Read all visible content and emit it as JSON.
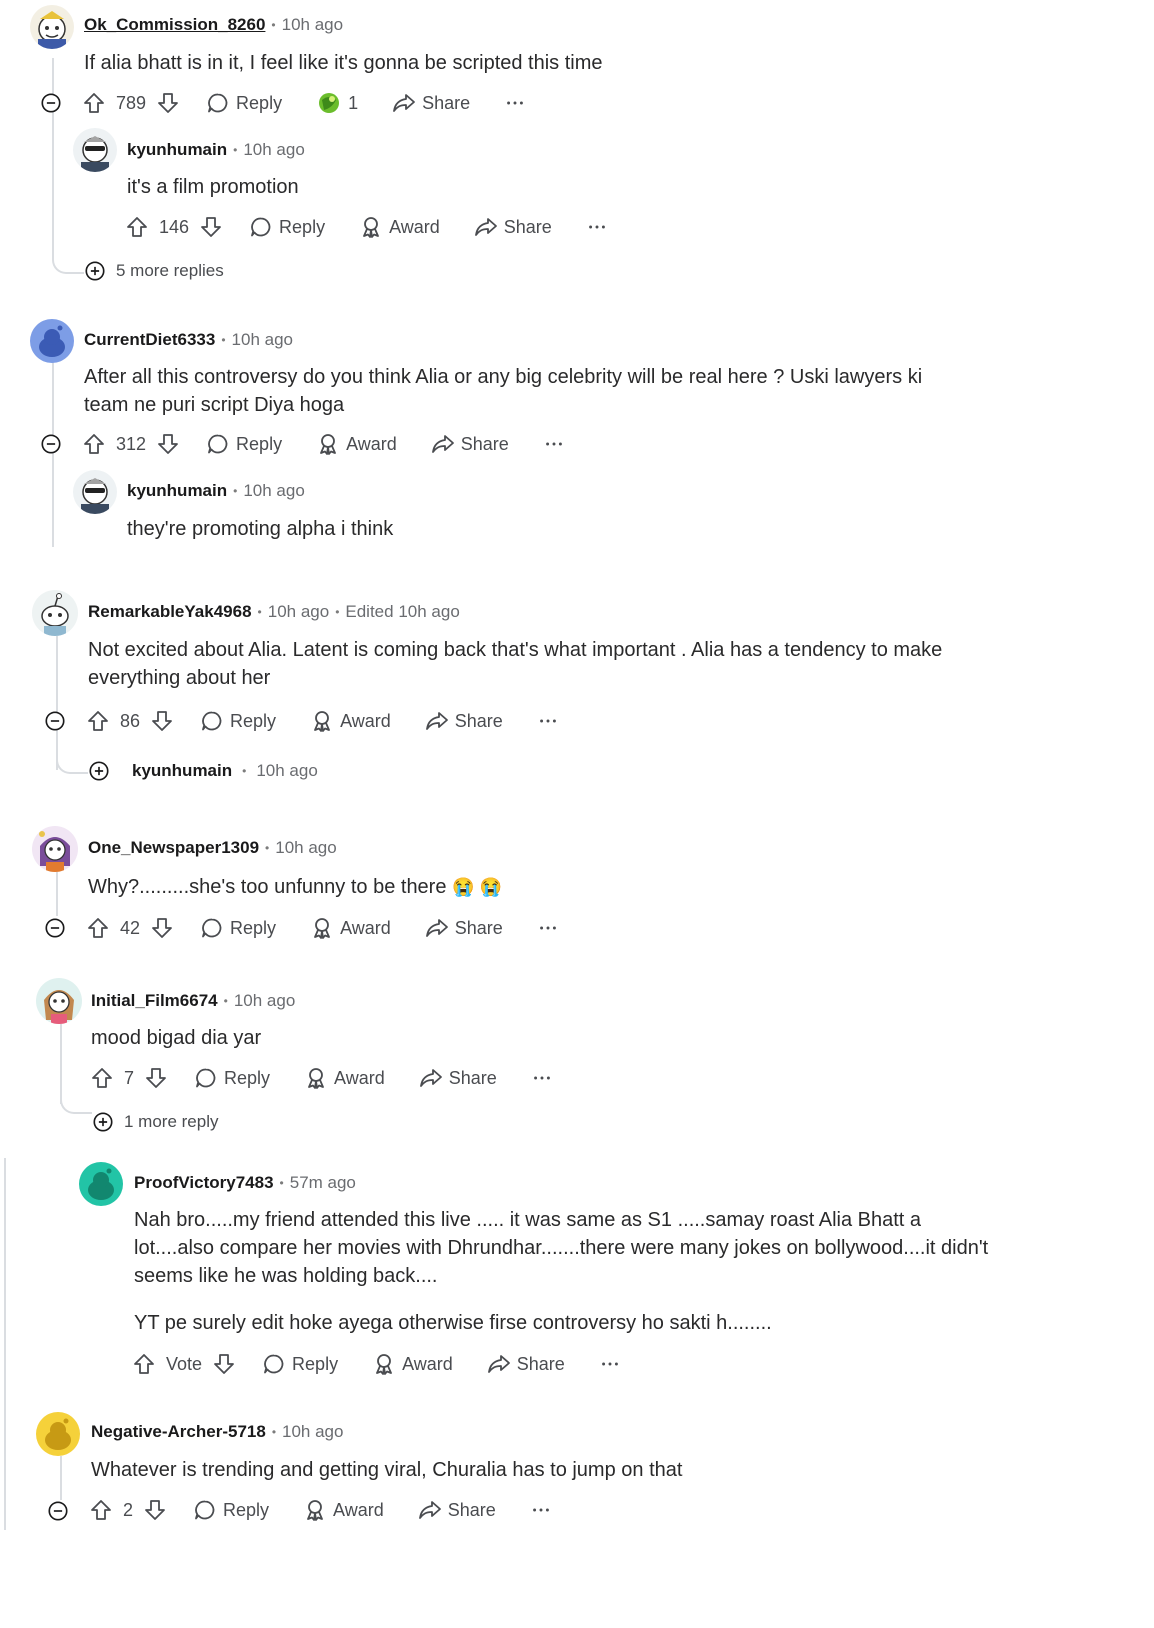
{
  "colors": {
    "text": "#1a1a1b",
    "meta": "#6a6c70",
    "line": "#dadde1",
    "action": "#4a4c50"
  },
  "comments": [
    {
      "id": "c1",
      "user": "Ok_Commission_8260",
      "time": "10h ago",
      "body": "If alia bhatt is in it, I feel like it's gonna be scripted this time",
      "votes": "789",
      "reply": "Reply",
      "award_count": "1",
      "share": "Share",
      "reply_children": [
        {
          "user": "kyunhumain",
          "time": "10h ago",
          "body": "it's a film promotion",
          "votes": "146",
          "reply": "Reply",
          "award": "Award",
          "share": "Share"
        }
      ],
      "more": "5 more replies"
    },
    {
      "id": "c2",
      "user": "CurrentDiet6333",
      "time": "10h ago",
      "body": "After all this controversy do you think Alia or any big celebrity will be real here ? Uski lawyers ki team ne puri script Diya hoga",
      "votes": "312",
      "reply": "Reply",
      "award": "Award",
      "share": "Share",
      "reply_children": [
        {
          "user": "kyunhumain",
          "time": "10h ago",
          "body": "they're promoting alpha i think"
        }
      ]
    },
    {
      "id": "c3",
      "user": "RemarkableYak4968",
      "time": "10h ago",
      "edited": "Edited 10h ago",
      "body": "Not excited about Alia. Latent is coming back that's what important . Alia has a tendency to make everything about her",
      "votes": "86",
      "reply": "Reply",
      "award": "Award",
      "share": "Share",
      "collapsed_child": {
        "user": "kyunhumain",
        "time": "10h ago"
      }
    },
    {
      "id": "c4",
      "user": "One_Newspaper1309",
      "time": "10h ago",
      "body": "Why?.........she's too unfunny to be there",
      "emoji": "😭 😭",
      "votes": "42",
      "reply": "Reply",
      "award": "Award",
      "share": "Share"
    },
    {
      "id": "c5",
      "user": "Initial_Film6674",
      "time": "10h ago",
      "body": "mood bigad dia yar",
      "votes": "7",
      "reply": "Reply",
      "award": "Award",
      "share": "Share",
      "more": "1 more reply"
    },
    {
      "id": "c6",
      "user": "ProofVictory7483",
      "time": "57m ago",
      "body": "Nah bro.....my friend attended this live ..... it was same as S1 .....samay roast Alia Bhatt a lot....also compare her movies with Dhrundhar.......there were many jokes on bollywood....it didn't seems like he was holding back....",
      "body2": "YT pe surely edit hoke ayega otherwise firse controversy ho sakti h........",
      "votes": "Vote",
      "reply": "Reply",
      "award": "Award",
      "share": "Share"
    },
    {
      "id": "c7",
      "user": "Negative-Archer-5718",
      "time": "10h ago",
      "body": "Whatever is trending and getting viral, Churalia has to jump on that",
      "votes": "2",
      "reply": "Reply",
      "award": "Award",
      "share": "Share"
    }
  ],
  "icons": [
    "upvote-icon",
    "downvote-icon",
    "reply-icon",
    "award-icon",
    "share-icon",
    "more-icon",
    "collapse-icon",
    "expand-icon"
  ]
}
